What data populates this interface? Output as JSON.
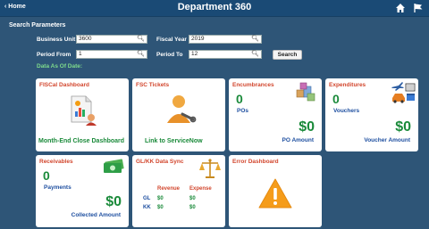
{
  "header": {
    "home_label": "Home",
    "title": "Department 360",
    "icons": [
      "home-icon",
      "flag-icon"
    ]
  },
  "search": {
    "title": "Search Parameters",
    "business_unit_label": "Business Unit",
    "business_unit_value": "3600",
    "fiscal_year_label": "Fiscal Year",
    "fiscal_year_value": "2019",
    "period_from_label": "Period From",
    "period_from_value": "1",
    "period_to_label": "Period To",
    "period_to_value": "12",
    "search_button": "Search",
    "data_as_of": "Data As Of Date:"
  },
  "tiles": {
    "fiscal": {
      "title": "FISCal Dashboard",
      "footer": "Month-End Close Dashboard"
    },
    "fsc": {
      "title": "FSC Tickets",
      "footer": "Link to ServiceNow"
    },
    "encumbrances": {
      "title": "Encumbrances",
      "count": "0",
      "count_label": "POs",
      "amount": "$0",
      "amount_label": "PO Amount"
    },
    "expenditures": {
      "title": "Expenditures",
      "count": "0",
      "count_label": "Vouchers",
      "amount": "$0",
      "amount_label": "Voucher Amount"
    },
    "receivables": {
      "title": "Receivables",
      "count": "0",
      "count_label": "Payments",
      "amount": "$0",
      "amount_label": "Collected Amount"
    },
    "glkk": {
      "title": "GL/KK Data Sync",
      "revenue_label": "Revenue",
      "expense_label": "Expense",
      "gl_label": "GL",
      "kk_label": "KK",
      "gl_revenue": "$0",
      "gl_expense": "$0",
      "kk_revenue": "$0",
      "kk_expense": "$0"
    },
    "error": {
      "title": "Error Dashboard"
    }
  },
  "colors": {
    "background": "#2e5577",
    "header": "#1a4a75",
    "tile_title": "#d2462d",
    "green": "#1a8a3a",
    "blue_label": "#1e4fa0",
    "data_as_of": "#7fdc8c"
  }
}
